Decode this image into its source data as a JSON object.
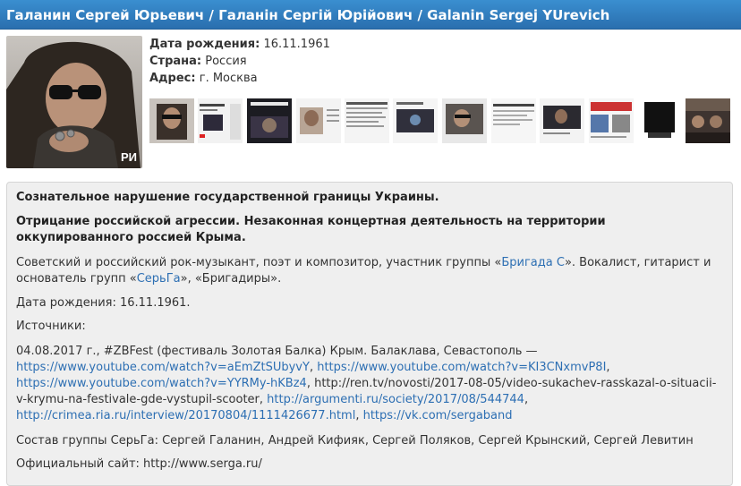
{
  "header": {
    "title": "Галанин Сергей Юрьевич / Галанін Сергій Юрійович / Galanin Sergej YUrevich"
  },
  "profile": {
    "birth_label": "Дата рождения:",
    "birth_value": "16.11.1961",
    "country_label": "Страна:",
    "country_value": "Россия",
    "address_label": "Адрес:",
    "address_value": "г. Москва",
    "photo_watermark": "РИ"
  },
  "thumbnails": [
    {
      "name": "thumb-1"
    },
    {
      "name": "thumb-2"
    },
    {
      "name": "thumb-3"
    },
    {
      "name": "thumb-4"
    },
    {
      "name": "thumb-5"
    },
    {
      "name": "thumb-6"
    },
    {
      "name": "thumb-7"
    },
    {
      "name": "thumb-8"
    },
    {
      "name": "thumb-9"
    },
    {
      "name": "thumb-10"
    },
    {
      "name": "thumb-11"
    },
    {
      "name": "thumb-12"
    }
  ],
  "content": {
    "heading1": "Сознательное нарушение государственной границы Украины.",
    "heading2": "Отрицание российской агрессии. Незаконная концертная деятельность на территории оккупированного россией Крыма.",
    "bio_text_1": "Советский и российский рок-музыкант, поэт и композитор, участник группы  «",
    "bio_link_1": "Бригада С",
    "bio_text_2": "». Вокалист, гитарист и основатель групп «",
    "bio_link_2": "СерьГа",
    "bio_text_3": "», «Бригадиры».",
    "birth_line": "Дата рождения: 16.11.1961.",
    "sources_label": "Источники:",
    "source_intro": "04.08.2017 г., #ZBFest (фестиваль Золотая Балка) Крым. Балаклава, Севастополь —",
    "link1": "https://www.youtube.com/watch?v=aEmZtSUbyvY",
    "link2": "https://www.youtube.com/watch?v=KI3CNxmvP8I",
    "link3": "https://www.youtube.com/watch?v=YYRMy-hKBz4",
    "plain_link": "http://ren.tv/novosti/2017-08-05/video-sukachev-rasskazal-o-situacii-v-krymu-na-festivale-gde-vystupil-scooter",
    "link4": "http://argumenti.ru/society/2017/08/544744",
    "link5": "http://crimea.ria.ru/interview/20170804/1111426677.html",
    "link6": "https://vk.com/sergaband",
    "band_line": "Состав группы СерьГа: Сергей Галанин, Андрей Кифияк, Сергей Поляков, Сергей Крынский, Сергей Левитин",
    "site_line": "Официальный сайт: http://www.serga.ru/"
  }
}
